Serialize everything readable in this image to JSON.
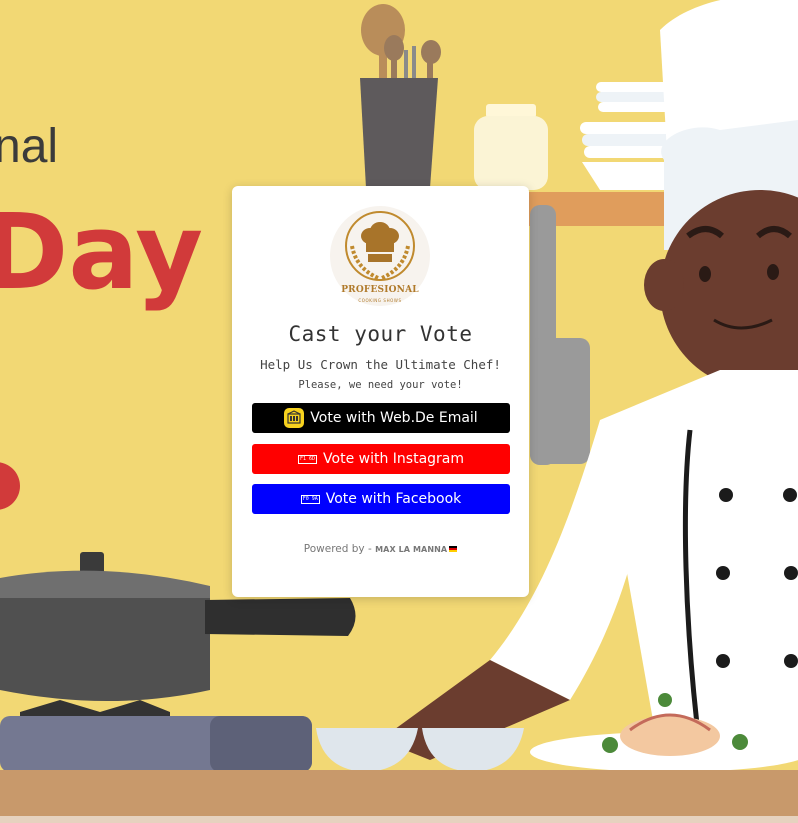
{
  "background": {
    "headline_partial_top": "nal",
    "headline_partial_main": "Day",
    "colors": {
      "wall": "#f2d874",
      "counter": "#c8996b",
      "accent_red": "#d13a3a"
    }
  },
  "card": {
    "logo": {
      "main_text": "PROFESIONAL",
      "sub_text": "COOKING SHOWS",
      "icon": "chef-hat-laurel-icon"
    },
    "title": "Cast your Vote",
    "subtitle": "Help Us Crown the Ultimate Chef!",
    "note": "Please, we need your vote!",
    "buttons": {
      "webde": {
        "label": "Vote with Web.De Email",
        "icon": "webde-logo-icon",
        "color": "#000000"
      },
      "instagram": {
        "label": "Vote with Instagram",
        "icon_glyph": "F1 6D",
        "color": "#ff0000"
      },
      "facebook": {
        "label": "Vote with Facebook",
        "icon_glyph": "F0 9A",
        "color": "#0000ff"
      }
    },
    "powered_by": {
      "prefix": "Powered by - ",
      "brand": "MAX LA MANNA",
      "flag": "germany-flag-icon"
    }
  }
}
